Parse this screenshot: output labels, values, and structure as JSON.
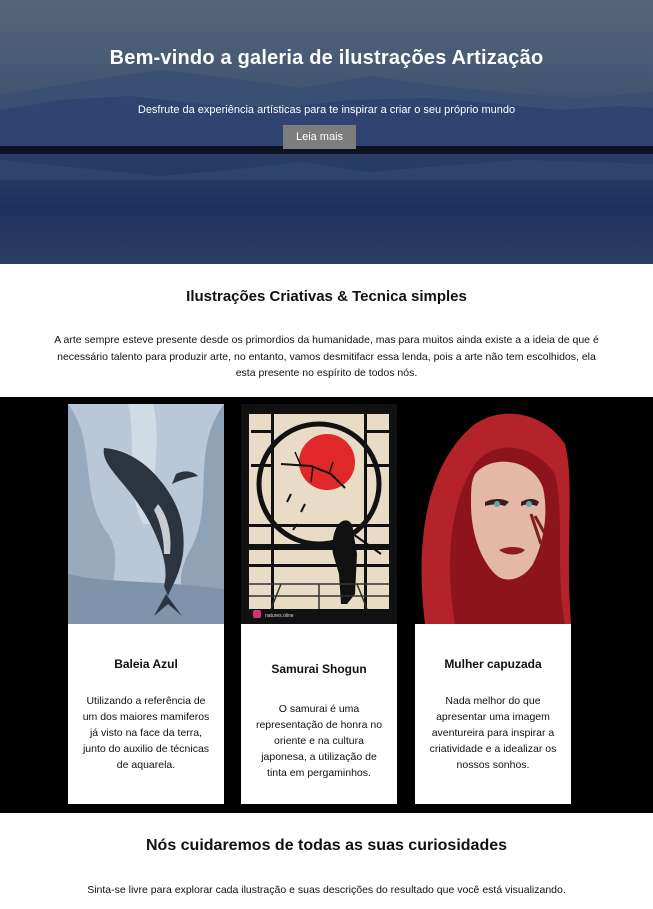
{
  "hero": {
    "title": "Bem-vindo a galeria de ilustrações Artização",
    "subtitle": "Desfrute da experiência artísticas para te inspirar a criar o seu próprio mundo",
    "button_label": "Leia mais"
  },
  "intro": {
    "title": "Ilustrações Criativas & Tecnica simples",
    "text": "A arte sempre esteve presente desde os primordios da humanidade, mas para muitos ainda existe a a ideia de que é necessário talento para produzir arte, no entanto, vamos desmitifacr essa lenda, pois a arte não tem escolhidos, ela esta presente no espírito de todos nós."
  },
  "cards": [
    {
      "title": "Baleia Azul",
      "text": "Utilizando a referência de um dos maiores mamiferos já visto na face da terra, junto do auxilio de técnicas de aquarela.",
      "image": "whale-illustration"
    },
    {
      "title": "Samurai Shogun",
      "text": "O samurai é uma representação de honra no oriente e na cultura japonesa, a utilização de tinta em pergaminhos.",
      "image": "samurai-illustration",
      "watermark": "natures.oline"
    },
    {
      "title": "Mulher capuzada",
      "text": "Nada melhor do que apresentar uma imagem aventureira para inspirar a criatividade e a idealizar os nossos sonhos.",
      "image": "hooded-woman-illustration"
    }
  ],
  "bottom": {
    "title": "Nós cuidaremos de todas as suas curiosidades",
    "text": "Sinta-se livre para explorar cada ilustração e suas descrições do resultado que você está visualizando."
  },
  "colors": {
    "button_bg": "#7d7d7d",
    "gallery_bg": "#000000",
    "samurai_sun": "#e0282b"
  }
}
